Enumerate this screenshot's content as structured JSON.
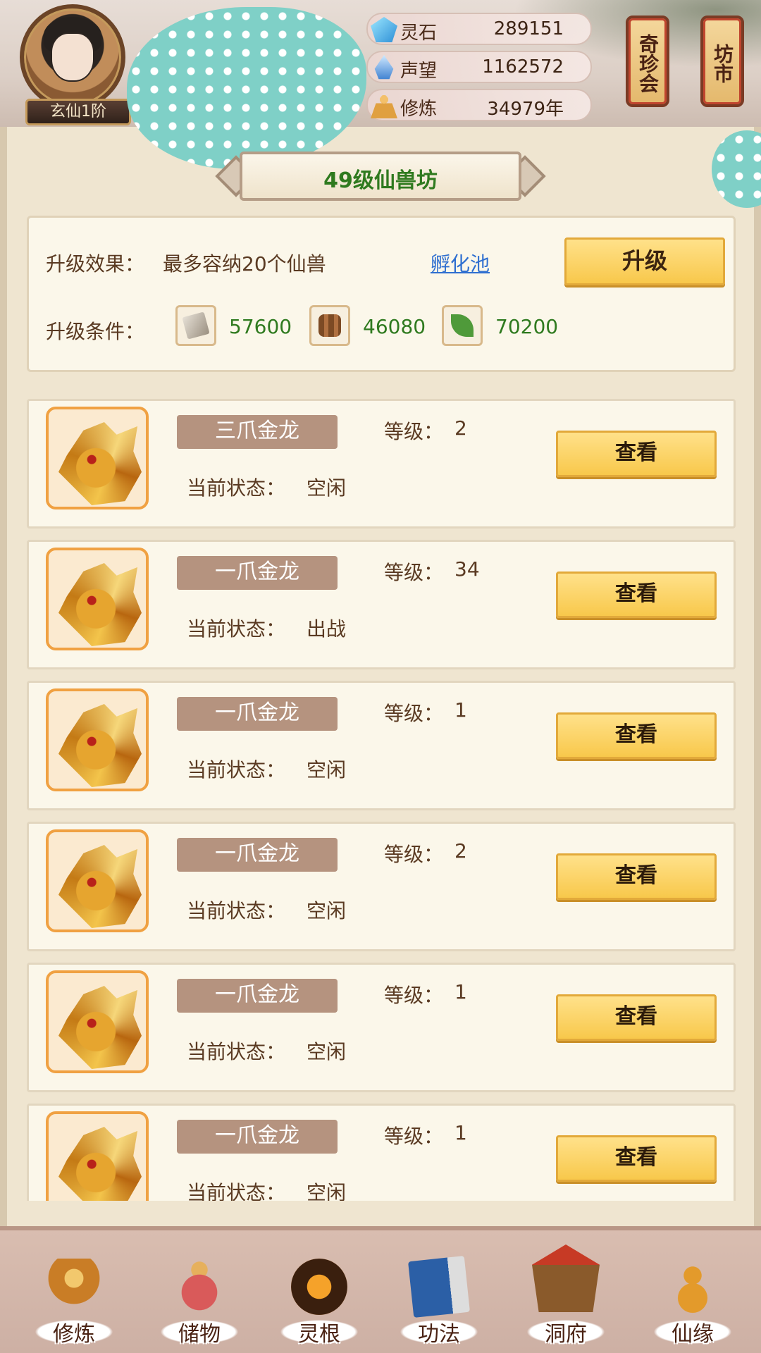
{
  "header": {
    "rank_badge": "玄仙1阶",
    "resources": [
      {
        "name": "灵石",
        "value": "289151",
        "icon": "spirit-stone-icon"
      },
      {
        "name": "声望",
        "value": "1162572",
        "icon": "reputation-icon"
      },
      {
        "name": "修炼",
        "value": "34979年",
        "icon": "cultivation-icon"
      }
    ],
    "lanterns": [
      {
        "label": "奇珍会"
      },
      {
        "label": "坊市"
      }
    ]
  },
  "panel": {
    "title": "49级仙兽坊",
    "upgrade": {
      "effect_label": "升级效果：",
      "effect_text": "最多容纳20个仙兽",
      "link_label": "孵化池",
      "button_label": "升级",
      "condition_label": "升级条件：",
      "conditions": [
        {
          "icon": "scroll-material-icon",
          "value": "57600"
        },
        {
          "icon": "wood-material-icon",
          "value": "46080"
        },
        {
          "icon": "herb-material-icon",
          "value": "70200"
        }
      ]
    },
    "beasts": [
      {
        "name": "三爪金龙",
        "level_label": "等级：",
        "level": "2",
        "status_label": "当前状态：",
        "status": "空闲",
        "button": "查看"
      },
      {
        "name": "一爪金龙",
        "level_label": "等级：",
        "level": "34",
        "status_label": "当前状态：",
        "status": "出战",
        "button": "查看"
      },
      {
        "name": "一爪金龙",
        "level_label": "等级：",
        "level": "1",
        "status_label": "当前状态：",
        "status": "空闲",
        "button": "查看"
      },
      {
        "name": "一爪金龙",
        "level_label": "等级：",
        "level": "2",
        "status_label": "当前状态：",
        "status": "空闲",
        "button": "查看"
      },
      {
        "name": "一爪金龙",
        "level_label": "等级：",
        "level": "1",
        "status_label": "当前状态：",
        "status": "空闲",
        "button": "查看"
      },
      {
        "name": "一爪金龙",
        "level_label": "等级：",
        "level": "1",
        "status_label": "当前状态：",
        "status": "空闲",
        "button": "查看"
      }
    ]
  },
  "bottom_nav": {
    "items": [
      {
        "label": "修炼",
        "icon": "cultivation-nav-icon"
      },
      {
        "label": "储物",
        "icon": "storage-bag-icon"
      },
      {
        "label": "灵根",
        "icon": "spirit-root-icon"
      },
      {
        "label": "功法",
        "icon": "technique-book-icon"
      },
      {
        "label": "洞府",
        "icon": "cave-dwelling-icon"
      },
      {
        "label": "仙缘",
        "icon": "immortal-fate-icon"
      }
    ]
  },
  "colors": {
    "accent_gold": "#f8c84b",
    "title_green": "#2f7a1f",
    "link_blue": "#2f6fd0",
    "name_tag": "#b5937f"
  }
}
